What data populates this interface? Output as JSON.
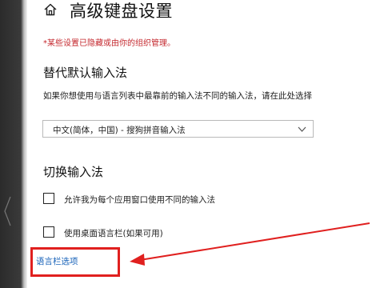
{
  "header": {
    "title": "高级键盘设置",
    "home_icon": "home-icon"
  },
  "notice": {
    "text": "*某些设置已隐藏或由你的组织管理。",
    "color": "#c4282e"
  },
  "override_section": {
    "heading": "替代默认输入法",
    "description": "如果你想使用与语言列表中最靠前的输入法不同的输入法，请在此处选择",
    "dropdown": {
      "selected": "中文(简体，中国) - 搜狗拼音输入法"
    }
  },
  "switch_section": {
    "heading": "切换输入法",
    "options": [
      {
        "label": "允许我为每个应用窗口使用不同的输入法",
        "checked": false
      },
      {
        "label": "使用桌面语言栏(如果可用)",
        "checked": false
      }
    ]
  },
  "language_bar_link": {
    "label": "语言栏选项",
    "color": "#1661b8"
  },
  "annotation": {
    "color": "#e0201f"
  }
}
